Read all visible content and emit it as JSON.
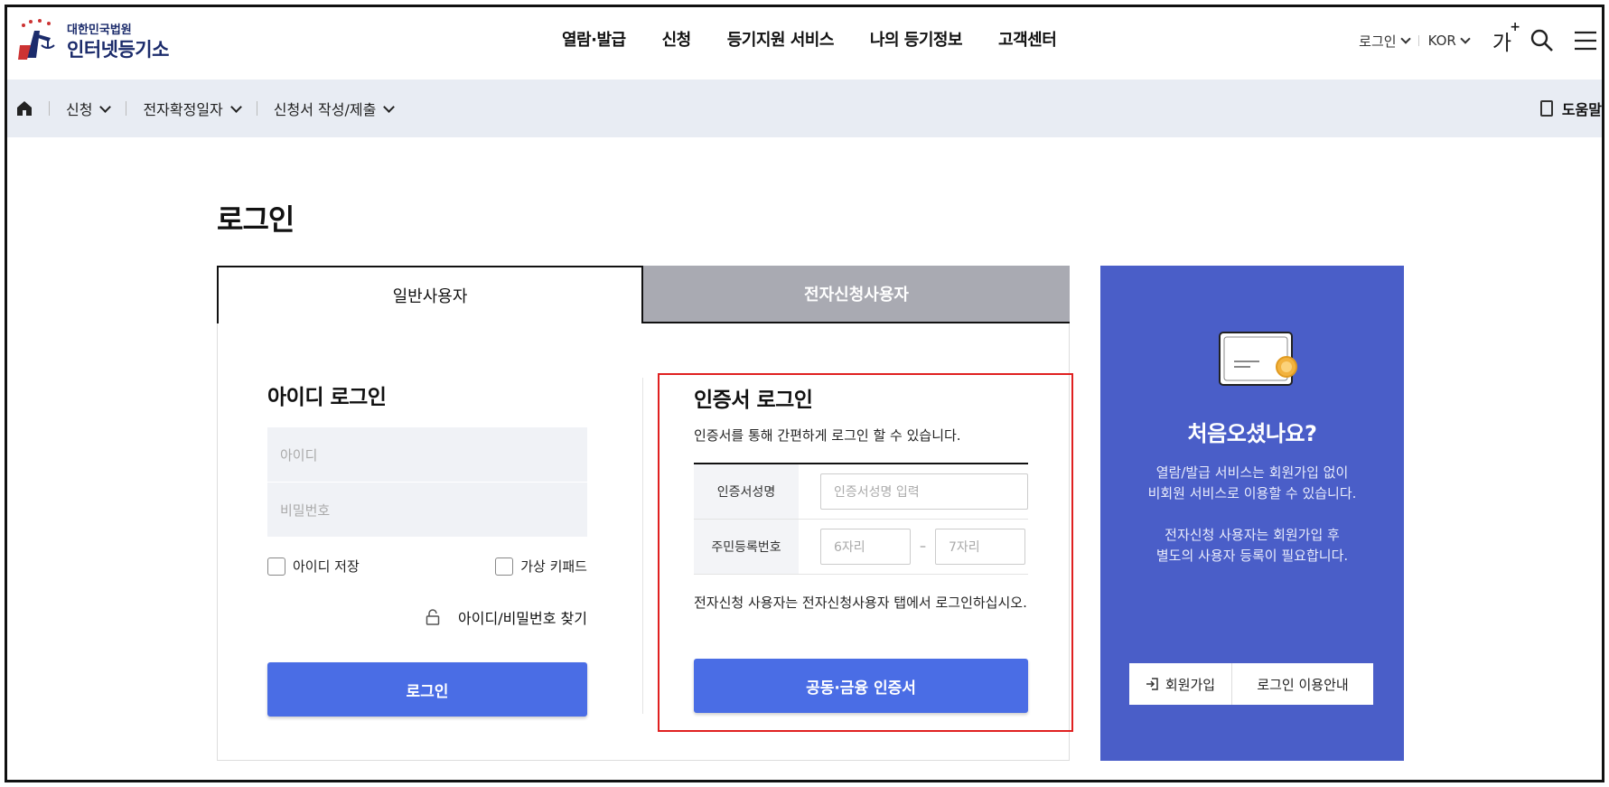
{
  "header": {
    "logo_sub": "대한민국법원",
    "logo_main": "인터넷등기소",
    "nav": [
      "열람·발급",
      "신청",
      "등기지원 서비스",
      "나의 등기정보",
      "고객센터"
    ],
    "login_link": "로그인",
    "lang": "KOR",
    "font_size_label": "가",
    "font_size_plus": "+"
  },
  "subnav": {
    "crumbs": [
      "신청",
      "전자확정일자",
      "신청서 작성/제출"
    ],
    "help_label": "도움말"
  },
  "main": {
    "page_title": "로그인",
    "tabs": [
      "일반사용자",
      "전자신청사용자"
    ],
    "id_login": {
      "title": "아이디 로그인",
      "id_placeholder": "아이디",
      "pw_placeholder": "비밀번호",
      "save_id": "아이디 저장",
      "virtual_keypad": "가상 키패드",
      "find_label": "아이디/비밀번호 찾기",
      "login_button": "로그인"
    },
    "cert_login": {
      "title": "인증서 로그인",
      "desc": "인증서를 통해 간편하게 로그인 할 수 있습니다.",
      "cert_name_label": "인증서성명",
      "cert_name_placeholder": "인증서성명 입력",
      "rrn_label": "주민등록번호",
      "rrn_front_placeholder": "6자리",
      "rrn_dash": "–",
      "rrn_back_placeholder": "7자리",
      "note": "전자신청 사용자는 전자신청사용자 탭에서 로그인하십시오.",
      "cert_button": "공동·금융 인증서"
    },
    "promo": {
      "title": "처음오셨나요?",
      "line1": "열람/발급 서비스는 회원가입 없이",
      "line2": "비회원 서비스로 이용할 수 있습니다.",
      "line3": "전자신청 사용자는 회원가입 후",
      "line4": "별도의 사용자 등록이 필요합니다.",
      "join_button": "회원가입",
      "guide_button": "로그인 이용안내"
    }
  },
  "colors": {
    "primary": "#4a6de5",
    "promo_bg": "#4a5ec8",
    "tab_inactive": "#a9aab2",
    "subnav_bg": "#e8ecf3",
    "highlight_border": "#e02020"
  }
}
